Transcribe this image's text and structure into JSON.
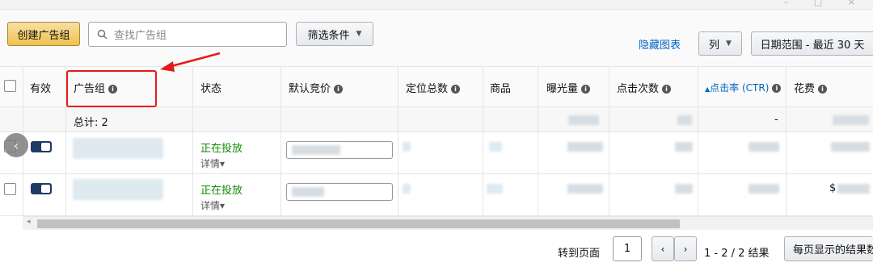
{
  "window": {
    "controls": "–  □  ×"
  },
  "toolbar": {
    "create_label": "创建广告组",
    "search_placeholder": "查找广告组",
    "filter_label": "筛选条件",
    "hide_chart_label": "隐藏图表",
    "columns_label": "列",
    "date_range_label": "日期范围 - 最近 30 天"
  },
  "table": {
    "headers": {
      "active": "有效",
      "ad_group": "广告组",
      "status": "状态",
      "default_bid": "默认竞价",
      "targeting_total": "定位总数",
      "products": "商品",
      "impressions": "曝光量",
      "clicks": "点击次数",
      "ctr": "点击率 (CTR)",
      "spend": "花费"
    },
    "sort_indicator": "▲",
    "totals": {
      "label": "总计: 2",
      "ctr": "-"
    },
    "rows": [
      {
        "status": "正在投放",
        "detail": "详情▾"
      },
      {
        "status": "正在投放",
        "detail": "详情▾",
        "spend_prefix": "$"
      }
    ]
  },
  "pagination": {
    "goto_label": "转到页面",
    "page": "1",
    "prev": "‹",
    "next": "›",
    "results": "1 - 2 / 2 结果",
    "per_page_label": "每页显示的结果数"
  },
  "icons": [
    "search-icon",
    "info-icon",
    "chevron-down-icon",
    "chevron-left-icon",
    "chevron-right-icon",
    "toggle-switch"
  ],
  "colors": {
    "primary_button": "#f0c14b",
    "link": "#0066c0",
    "status_green": "#108a00",
    "toggle": "#1f3b63",
    "annotation": "#e31b1b"
  }
}
